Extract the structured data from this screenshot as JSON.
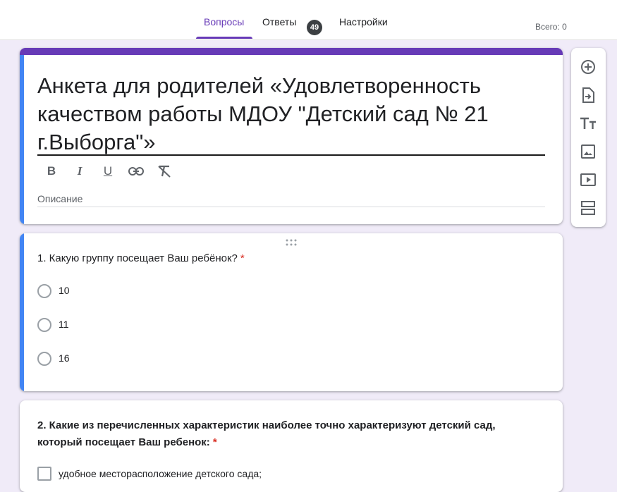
{
  "tabs": {
    "questions": "Вопросы",
    "responses": "Ответы",
    "responses_count": "49",
    "settings": "Настройки"
  },
  "total_label": "Всего: 0",
  "form": {
    "title": "Анкета для родителей «Удовлетворенность качеством работы МДОУ \"Детский сад № 21 г.Выборга\"»",
    "description_placeholder": "Описание"
  },
  "question1": {
    "title": "1. Какую группу посещает Ваш ребёнок?",
    "required_mark": "*",
    "options": [
      "10",
      "11",
      "16"
    ]
  },
  "question2": {
    "title": "2. Какие из перечисленных характеристик наиболее точно характеризуют детский сад, который посещает Ваш ребенок:",
    "required_mark": "*",
    "options": [
      "удобное месторасположение детского сада;"
    ]
  },
  "icons": {
    "bold": "bold-icon",
    "italic": "italic-icon",
    "underline": "underline-icon",
    "link": "link-icon",
    "clear_format": "clear-format-icon",
    "add_question": "add-circle-icon",
    "import_questions": "import-icon",
    "add_title": "title-text-icon",
    "add_image": "image-icon",
    "add_video": "video-icon",
    "add_section": "section-icon"
  },
  "colors": {
    "accent": "#673ab7",
    "active_indicator": "#4285f4",
    "background": "#f0ebf8",
    "required": "#d93025"
  }
}
